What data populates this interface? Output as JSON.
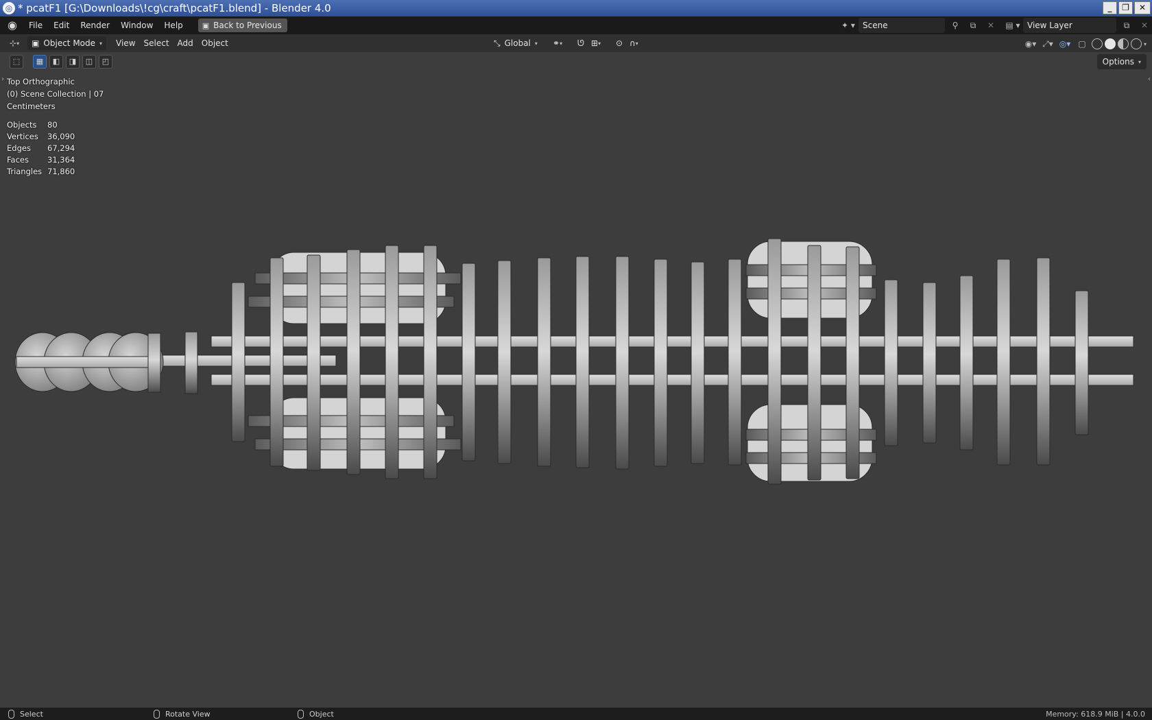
{
  "window": {
    "title": "* pcatF1 [G:\\Downloads\\!cg\\craft\\pcatF1.blend] - Blender 4.0",
    "buttons": {
      "minimize": "_",
      "maximize": "❐",
      "close": "✕"
    }
  },
  "menubar": {
    "items": [
      "File",
      "Edit",
      "Render",
      "Window",
      "Help"
    ],
    "back_label": "Back to Previous",
    "scene_label": "Scene",
    "view_layer_label": "View Layer"
  },
  "header": {
    "mode": "Object Mode",
    "menus": [
      "View",
      "Select",
      "Add",
      "Object"
    ],
    "orientation": "Global"
  },
  "viewport": {
    "view_name": "Top Orthographic",
    "collection": "(0) Scene Collection | 07",
    "units": "Centimeters",
    "options_label": "Options",
    "stats": [
      {
        "label": "Objects",
        "value": "80"
      },
      {
        "label": "Vertices",
        "value": "36,090"
      },
      {
        "label": "Edges",
        "value": "67,294"
      },
      {
        "label": "Faces",
        "value": "31,364"
      },
      {
        "label": "Triangles",
        "value": "71,860"
      }
    ]
  },
  "statusbar": {
    "hints": [
      "Select",
      "Rotate View",
      "Object"
    ],
    "memory": "Memory: 618.9 MiB | 4.0.0"
  },
  "colors": {
    "viewport_bg": "#3d3d3d",
    "header_bg": "#303030",
    "accent_selected": "#4772b3"
  }
}
